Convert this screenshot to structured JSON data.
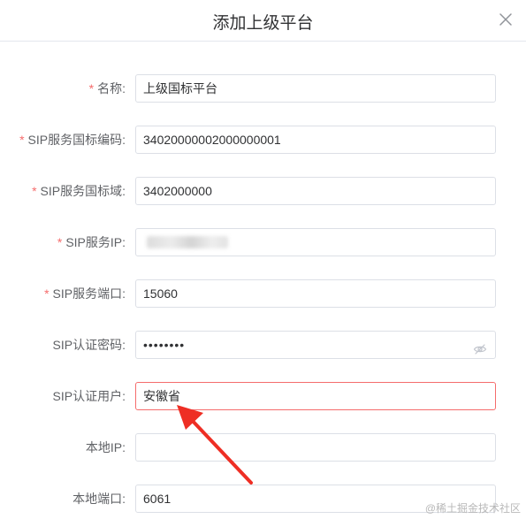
{
  "dialog": {
    "title": "添加上级平台"
  },
  "form": {
    "required_mark": "*",
    "fields": [
      {
        "label": "名称:",
        "required": true,
        "value": "上级国标平台"
      },
      {
        "label": "SIP服务国标编码:",
        "required": true,
        "value": "34020000002000000001"
      },
      {
        "label": "SIP服务国标域:",
        "required": true,
        "value": "3402000000"
      },
      {
        "label": "SIP服务IP:",
        "required": true,
        "value": ""
      },
      {
        "label": "SIP服务端口:",
        "required": true,
        "value": "15060"
      },
      {
        "label": "SIP认证密码:",
        "required": false,
        "value": "••••••••"
      },
      {
        "label": "SIP认证用户:",
        "required": false,
        "value": "安徽省"
      },
      {
        "label": "本地IP:",
        "required": false,
        "value": ""
      },
      {
        "label": "本地端口:",
        "required": false,
        "value": "6061"
      }
    ]
  },
  "annotation": {
    "arrow_color": "#ee2e24"
  },
  "watermark": "@稀土掘金技术社区",
  "colors": {
    "required": "#f56c6c",
    "error_border": "#f56c6c",
    "border": "#dcdfe6"
  }
}
